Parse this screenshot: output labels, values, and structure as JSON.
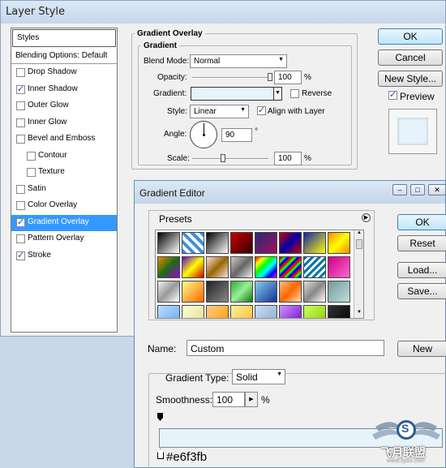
{
  "layer_style": {
    "title": "Layer Style",
    "styles_header": "Styles",
    "blending": "Blending Options: Default",
    "items": [
      {
        "label": "Drop Shadow",
        "checked": false,
        "sub": false,
        "selected": false
      },
      {
        "label": "Inner Shadow",
        "checked": true,
        "sub": false,
        "selected": false
      },
      {
        "label": "Outer Glow",
        "checked": false,
        "sub": false,
        "selected": false
      },
      {
        "label": "Inner Glow",
        "checked": false,
        "sub": false,
        "selected": false
      },
      {
        "label": "Bevel and Emboss",
        "checked": false,
        "sub": false,
        "selected": false
      },
      {
        "label": "Contour",
        "checked": false,
        "sub": true,
        "selected": false
      },
      {
        "label": "Texture",
        "checked": false,
        "sub": true,
        "selected": false
      },
      {
        "label": "Satin",
        "checked": false,
        "sub": false,
        "selected": false
      },
      {
        "label": "Color Overlay",
        "checked": false,
        "sub": false,
        "selected": false
      },
      {
        "label": "Gradient Overlay",
        "checked": true,
        "sub": false,
        "selected": true
      },
      {
        "label": "Pattern Overlay",
        "checked": false,
        "sub": false,
        "selected": false
      },
      {
        "label": "Stroke",
        "checked": true,
        "sub": false,
        "selected": false
      }
    ],
    "panel": {
      "group_title": "Gradient Overlay",
      "sub_title": "Gradient",
      "blend_mode_label": "Blend Mode:",
      "blend_mode": "Normal",
      "opacity_label": "Opacity:",
      "opacity": "100",
      "pct": "%",
      "gradient_label": "Gradient:",
      "reverse_label": "Reverse",
      "style_label": "Style:",
      "style": "Linear",
      "align_label": "Align with Layer",
      "angle_label": "Angle:",
      "angle": "90",
      "deg": "°",
      "scale_label": "Scale:",
      "scale": "100",
      "opacity_level": 1.0,
      "scale_level": 0.4
    },
    "buttons": {
      "ok": "OK",
      "cancel": "Cancel",
      "new_style": "New Style...",
      "preview": "Preview"
    }
  },
  "gradient_editor": {
    "title": "Gradient Editor",
    "presets_label": "Presets",
    "buttons": {
      "ok": "OK",
      "reset": "Reset",
      "load": "Load...",
      "save": "Save...",
      "new": "New"
    },
    "name_label": "Name:",
    "name_value": "Custom",
    "type_label": "Gradient Type:",
    "type_value": "Solid",
    "smoothness_label": "Smoothness:",
    "smoothness_value": "100",
    "pct": "%",
    "color_hex": "#e6f3fb"
  },
  "watermark": {
    "text": "S",
    "caption": "飞月联盟",
    "url": "www.5yue.com"
  },
  "swatches": [
    "linear-gradient(135deg,#000,#fff)",
    "repeating-linear-gradient(45deg,#3a8fe0 0 4px,#fff 4px 8px)",
    "linear-gradient(135deg,#000,#fff)",
    "linear-gradient(135deg,#c00,#300)",
    "linear-gradient(135deg,#2a2a7a,#a0105a)",
    "linear-gradient(135deg,#c00,#00a,#c00)",
    "linear-gradient(135deg,#12a,#ff0)",
    "linear-gradient(135deg,#f80,#ff0,#f80)",
    "linear-gradient(135deg,#e80,#1a6a1a,#a0c)",
    "linear-gradient(135deg,#60c,#ff0,#c00)",
    "linear-gradient(135deg,#fdd,#960,#fdd)",
    "linear-gradient(135deg,#ccc,#666,#eee)",
    "linear-gradient(135deg,#f00,#ff0,#0f0,#0ff,#00f,#f0f)",
    "repeating-linear-gradient(135deg,#f00 0 3px,#0f0 3px 6px,#00f 6px 9px)",
    "repeating-linear-gradient(135deg,#07a 0 3px,#fff 3px 6px)",
    "linear-gradient(135deg,#c08,#f6c)",
    "linear-gradient(135deg,#eee,#999,#fff)",
    "linear-gradient(135deg,#ff8,#f60)",
    "linear-gradient(135deg,#222,#888)",
    "linear-gradient(135deg,#3a3,#9e9,#171)",
    "linear-gradient(135deg,#8ce,#139)",
    "linear-gradient(135deg,#fb8,#f60,#fda)",
    "linear-gradient(135deg,#ddd,#888,#fff)",
    "linear-gradient(135deg,#799,#bdd)",
    "linear-gradient(135deg,#bdf,#6ae)",
    "linear-gradient(135deg,#ffd,#dd8)",
    "linear-gradient(135deg,#fc8,#f90)",
    "linear-gradient(135deg,#fe9,#fb3)",
    "linear-gradient(135deg,#cdf,#8ab)",
    "linear-gradient(135deg,#c9f,#70c)",
    "linear-gradient(135deg,#cf6,#8c0)",
    "linear-gradient(135deg,#333,#000)"
  ]
}
